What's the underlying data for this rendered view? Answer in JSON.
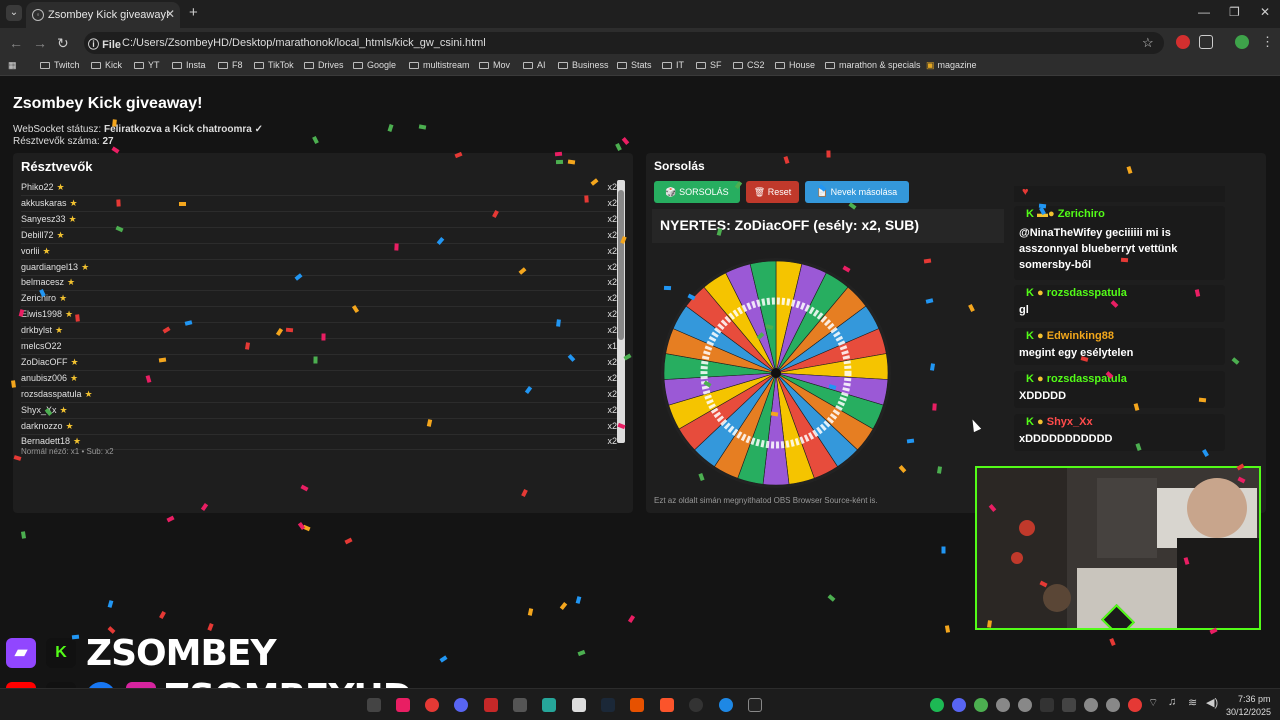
{
  "browser": {
    "tab_title": "Zsombey Kick giveaway!",
    "url_scheme_chip": "File",
    "url": "C:/Users/ZsombeyHD/Desktop/marathonok/local_htmls/kick_gw_csini.html",
    "bookmarks": [
      "Twitch",
      "Kick",
      "YT",
      "Insta",
      "F8",
      "TikTok",
      "Drives",
      "Google",
      "multistream",
      "Mov",
      "AI",
      "Business",
      "Stats",
      "IT",
      "SF",
      "CS2",
      "House",
      "marathon & specials",
      "magazine"
    ]
  },
  "page": {
    "title": "Zsombey Kick giveaway!",
    "ws_label": "WebSocket státusz:",
    "ws_value": "Feliratkozva a Kick chatroomra ✓",
    "count_label": "Résztvevők száma:",
    "count_value": "27"
  },
  "participants": {
    "title": "Résztvevők",
    "rows": [
      {
        "name": "Phiko22",
        "star": "★",
        "mult": "x2"
      },
      {
        "name": "akkuskaras",
        "star": "★",
        "mult": "x2"
      },
      {
        "name": "Sanyesz33",
        "star": "★",
        "mult": "x2"
      },
      {
        "name": "Debill72",
        "star": "★",
        "mult": "x2"
      },
      {
        "name": "vorlii",
        "star": "★",
        "mult": "x2"
      },
      {
        "name": "guardiangel13",
        "star": "★",
        "mult": "x2"
      },
      {
        "name": "belmacesz",
        "star": "★",
        "mult": "x2"
      },
      {
        "name": "Zerichiro",
        "star": "★",
        "mult": "x2"
      },
      {
        "name": "Elwis1998",
        "star": "★",
        "mult": "x2"
      },
      {
        "name": "drkbylst",
        "star": "★",
        "mult": "x2"
      },
      {
        "name": "melcsO22",
        "star": "",
        "mult": "x1"
      },
      {
        "name": "ZoDiacOFF",
        "star": "★",
        "mult": "x2"
      },
      {
        "name": "anubisz006",
        "star": "★",
        "mult": "x2"
      },
      {
        "name": "rozsdasspatula",
        "star": "★",
        "mult": "x2"
      },
      {
        "name": "Shyx_Xx",
        "star": "★",
        "mult": "x2"
      },
      {
        "name": "darknozzo",
        "star": "★",
        "mult": "x2"
      },
      {
        "name": "Bernadett18",
        "star": "★",
        "mult": "x2"
      }
    ],
    "weights_note": "Normál néző: x1 • Sub: x2"
  },
  "draw": {
    "title": "Sorsolás",
    "btn_draw": "🎲 SORSOLÁS",
    "btn_reset": "🗑 Reset",
    "btn_copy": "📋 Nevek másolása",
    "winner": "NYERTES: ZoDiacOFF (esély: x2, SUB)",
    "obs_note": "Ezt az oldalt simán megnyithatod OBS Browser Source-ként is.",
    "wheel_colors": [
      "#f5c400",
      "#9b59d6",
      "#27ae60",
      "#e67e22",
      "#3498db",
      "#e74c3c"
    ]
  },
  "chat": [
    {
      "user": "Zerichiro",
      "color": "#53fc18",
      "text": "@NinaTheWifey geciiiiii mi is asszonnyal blueberryt vettünk somersby-ből"
    },
    {
      "user": "rozsdasspatula",
      "color": "#53fc18",
      "text": "gl"
    },
    {
      "user": "Edwinking88",
      "color": "#f2a71b",
      "text": "megint egy esélytelen"
    },
    {
      "user": "rozsdasspatula",
      "color": "#53fc18",
      "text": "XDDDDD"
    },
    {
      "user": "Shyx_Xx",
      "color": "#ff4b4b",
      "text": "xDDDDDDDDDDD"
    }
  ],
  "overlay": {
    "handle_top": "ZSOMBEY",
    "handle_bottom": "ZSOMBEYHD"
  },
  "taskbar": {
    "time": "7:36 pm",
    "date": "30/12/2025"
  }
}
